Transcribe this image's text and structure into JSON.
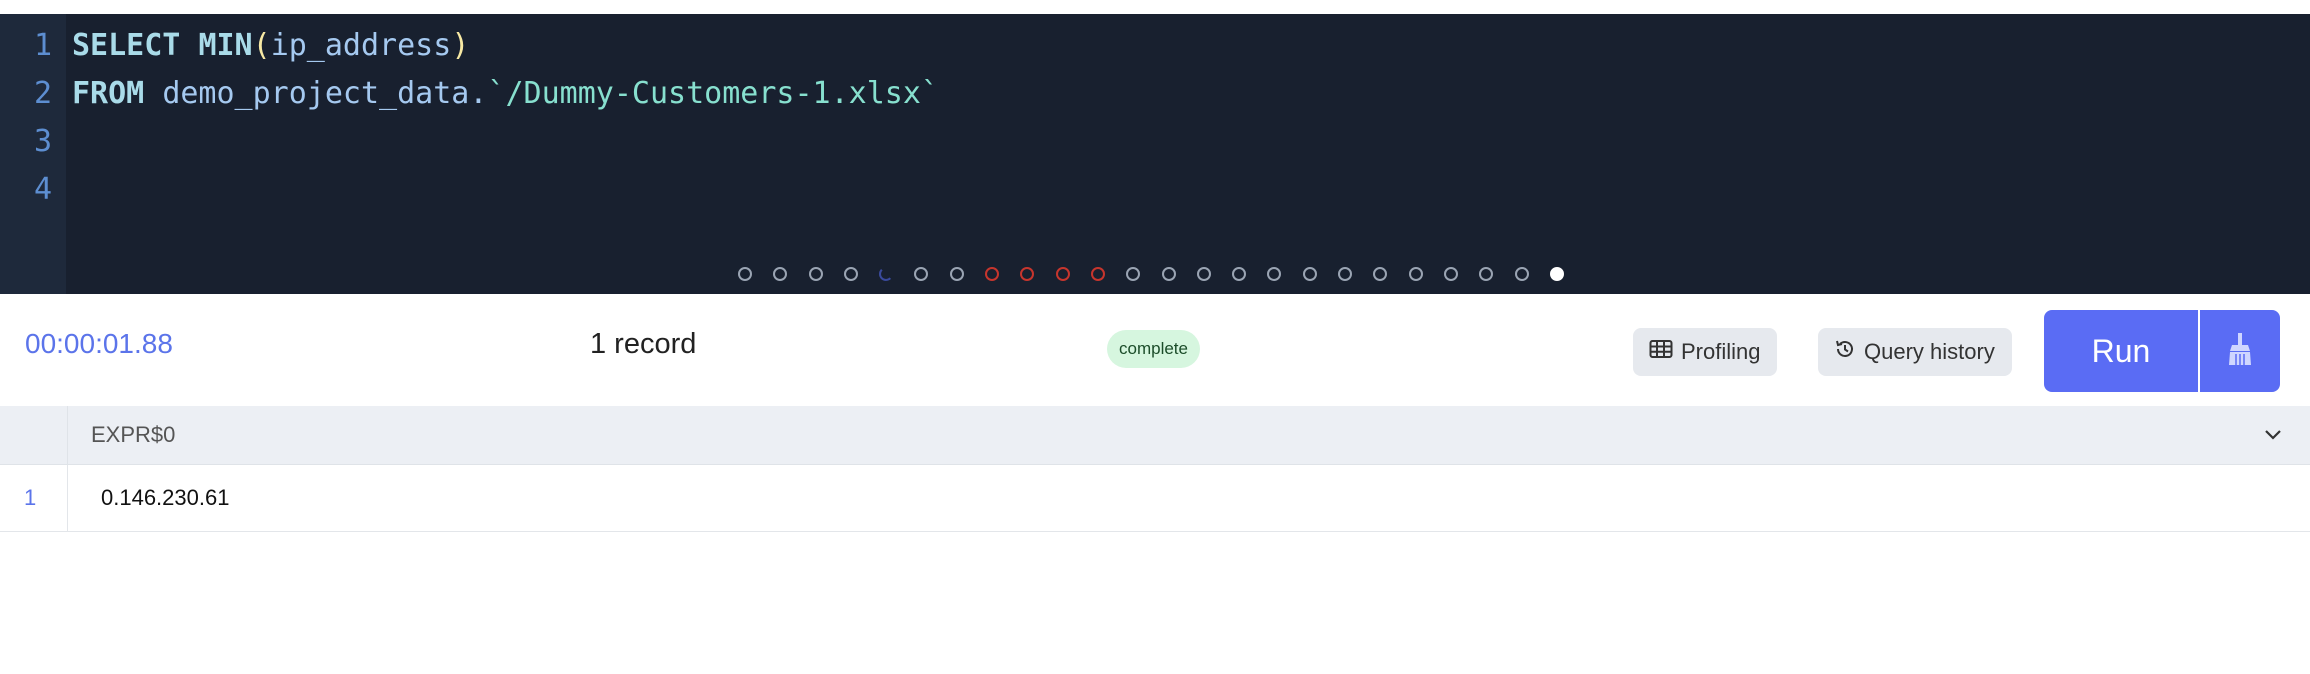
{
  "editor": {
    "line_numbers": [
      "1",
      "2",
      "3",
      "4"
    ],
    "line1": {
      "kw1": "SELECT",
      "fn": "MIN",
      "open": "(",
      "arg": "ip_address",
      "close": ")"
    },
    "line2": {
      "kw": "FROM",
      "schema": "demo_project_data.",
      "table": "`/Dummy-Customers-1.xlsx`"
    }
  },
  "pager": {
    "total": 24,
    "active_index": 23,
    "states": [
      "normal",
      "normal",
      "normal",
      "normal",
      "loading",
      "normal",
      "normal",
      "error",
      "error",
      "error",
      "error",
      "normal",
      "normal",
      "normal",
      "normal",
      "normal",
      "normal",
      "normal",
      "normal",
      "normal",
      "normal",
      "normal",
      "normal",
      "active"
    ]
  },
  "toolbar": {
    "elapsed": "00:00:01.88",
    "record_count": "1 record",
    "status": "complete",
    "profiling_label": "Profiling",
    "history_label": "Query history",
    "run_label": "Run"
  },
  "results": {
    "columns": [
      "EXPR$0"
    ],
    "rows": [
      {
        "row_number": "1",
        "values": [
          "0.146.230.61"
        ]
      }
    ]
  },
  "colors": {
    "accent": "#5a6cf4",
    "editor_bg": "#18202f",
    "status_bg": "#d6f6df",
    "error": "#c6352d"
  },
  "icons": {
    "profiling": "table-icon",
    "history": "history-icon",
    "clear": "broom-icon",
    "expand": "chevron-down-icon"
  }
}
